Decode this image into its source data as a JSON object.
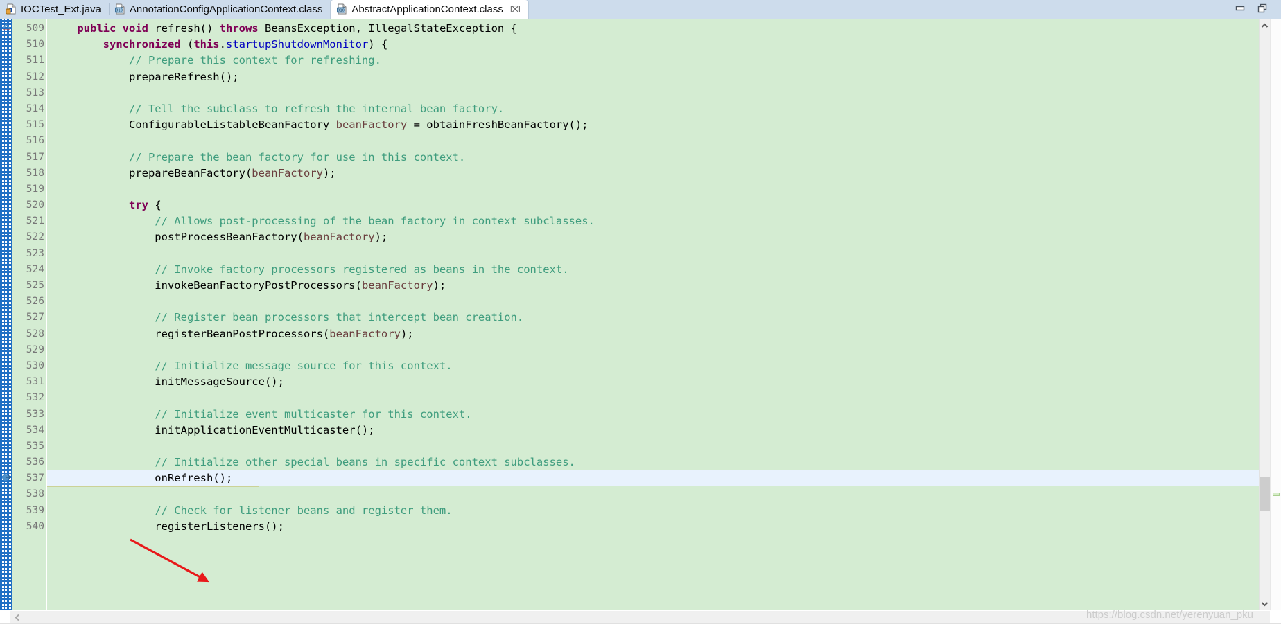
{
  "window": {
    "minimize_label": "Minimize",
    "restore_label": "Restore",
    "min_icon": "minimize-icon",
    "restore_icon": "restore-icon"
  },
  "tabs": [
    {
      "label": "IOCTest_Ext.java",
      "icon": "java-file-icon",
      "active": false,
      "closable": false
    },
    {
      "label": "AnnotationConfigApplicationContext.class",
      "icon": "class-file-icon",
      "active": false,
      "closable": false
    },
    {
      "label": "AbstractApplicationContext.class",
      "icon": "class-file-icon",
      "active": true,
      "closable": true,
      "close_glyph": "⌧"
    }
  ],
  "editor": {
    "first_line": 509,
    "current_line": 537,
    "gutter_marker_icon": "method-override-marker-icon",
    "folding_marker_icon": "fold-collapse-icon",
    "colors": {
      "background": "#d4ecd2",
      "current_line": "#e8f2fd",
      "selection": "#cbd297",
      "keyword": "#7f0055",
      "comment": "#3f9d7e",
      "field": "#0000c0",
      "local_var": "#6a3e3e",
      "plain": "#000000",
      "line_number": "#787878",
      "annotation_bar": "#1f6fc4"
    },
    "lines": [
      {
        "n": 509,
        "tokens": [
          {
            "t": "    ",
            "c": "pln"
          },
          {
            "t": "public",
            "c": "kw"
          },
          {
            "t": " ",
            "c": "pln"
          },
          {
            "t": "void",
            "c": "kw"
          },
          {
            "t": " refresh() ",
            "c": "pln"
          },
          {
            "t": "throws",
            "c": "kw"
          },
          {
            "t": " BeansException, IllegalStateException {",
            "c": "pln"
          }
        ]
      },
      {
        "n": 510,
        "tokens": [
          {
            "t": "        ",
            "c": "pln"
          },
          {
            "t": "synchronized",
            "c": "kw"
          },
          {
            "t": " (",
            "c": "pln"
          },
          {
            "t": "this",
            "c": "kw"
          },
          {
            "t": ".",
            "c": "pln"
          },
          {
            "t": "startupShutdownMonitor",
            "c": "fld"
          },
          {
            "t": ") {",
            "c": "pln"
          }
        ]
      },
      {
        "n": 511,
        "tokens": [
          {
            "t": "            ",
            "c": "pln"
          },
          {
            "t": "// Prepare this context for refreshing.",
            "c": "cmt"
          }
        ]
      },
      {
        "n": 512,
        "tokens": [
          {
            "t": "            prepareRefresh();",
            "c": "pln"
          }
        ]
      },
      {
        "n": 513,
        "tokens": [
          {
            "t": "",
            "c": "pln"
          }
        ]
      },
      {
        "n": 514,
        "tokens": [
          {
            "t": "            ",
            "c": "pln"
          },
          {
            "t": "// Tell the subclass to refresh the internal bean factory.",
            "c": "cmt"
          }
        ]
      },
      {
        "n": 515,
        "tokens": [
          {
            "t": "            ConfigurableListableBeanFactory ",
            "c": "pln"
          },
          {
            "t": "beanFactory",
            "c": "loc"
          },
          {
            "t": " = obtainFreshBeanFactory();",
            "c": "pln"
          }
        ]
      },
      {
        "n": 516,
        "tokens": [
          {
            "t": "",
            "c": "pln"
          }
        ]
      },
      {
        "n": 517,
        "tokens": [
          {
            "t": "            ",
            "c": "pln"
          },
          {
            "t": "// Prepare the bean factory for use in this context.",
            "c": "cmt"
          }
        ]
      },
      {
        "n": 518,
        "tokens": [
          {
            "t": "            prepareBeanFactory(",
            "c": "pln"
          },
          {
            "t": "beanFactory",
            "c": "loc"
          },
          {
            "t": ");",
            "c": "pln"
          }
        ]
      },
      {
        "n": 519,
        "tokens": [
          {
            "t": "",
            "c": "pln"
          }
        ]
      },
      {
        "n": 520,
        "tokens": [
          {
            "t": "            ",
            "c": "pln"
          },
          {
            "t": "try",
            "c": "kw"
          },
          {
            "t": " {",
            "c": "pln"
          }
        ]
      },
      {
        "n": 521,
        "tokens": [
          {
            "t": "                ",
            "c": "pln"
          },
          {
            "t": "// Allows post-processing of the bean factory in context subclasses.",
            "c": "cmt"
          }
        ]
      },
      {
        "n": 522,
        "tokens": [
          {
            "t": "                postProcessBeanFactory(",
            "c": "pln"
          },
          {
            "t": "beanFactory",
            "c": "loc"
          },
          {
            "t": ");",
            "c": "pln"
          }
        ]
      },
      {
        "n": 523,
        "tokens": [
          {
            "t": "",
            "c": "pln"
          }
        ]
      },
      {
        "n": 524,
        "tokens": [
          {
            "t": "                ",
            "c": "pln"
          },
          {
            "t": "// Invoke factory processors registered as beans in the context.",
            "c": "cmt"
          }
        ]
      },
      {
        "n": 525,
        "tokens": [
          {
            "t": "                invokeBeanFactoryPostProcessors(",
            "c": "pln"
          },
          {
            "t": "beanFactory",
            "c": "loc"
          },
          {
            "t": ");",
            "c": "pln"
          }
        ]
      },
      {
        "n": 526,
        "tokens": [
          {
            "t": "",
            "c": "pln"
          }
        ]
      },
      {
        "n": 527,
        "tokens": [
          {
            "t": "                ",
            "c": "pln"
          },
          {
            "t": "// Register bean processors that intercept bean creation.",
            "c": "cmt"
          }
        ]
      },
      {
        "n": 528,
        "tokens": [
          {
            "t": "                registerBeanPostProcessors(",
            "c": "pln"
          },
          {
            "t": "beanFactory",
            "c": "loc"
          },
          {
            "t": ");",
            "c": "pln"
          }
        ]
      },
      {
        "n": 529,
        "tokens": [
          {
            "t": "",
            "c": "pln"
          }
        ]
      },
      {
        "n": 530,
        "tokens": [
          {
            "t": "                ",
            "c": "pln"
          },
          {
            "t": "// Initialize message source for this context.",
            "c": "cmt"
          }
        ]
      },
      {
        "n": 531,
        "tokens": [
          {
            "t": "                initMessageSource();",
            "c": "pln"
          }
        ]
      },
      {
        "n": 532,
        "tokens": [
          {
            "t": "",
            "c": "pln"
          }
        ]
      },
      {
        "n": 533,
        "tokens": [
          {
            "t": "                ",
            "c": "pln"
          },
          {
            "t": "// Initialize event multicaster for this context.",
            "c": "cmt"
          }
        ]
      },
      {
        "n": 534,
        "tokens": [
          {
            "t": "                initApplicationEventMulticaster();",
            "c": "pln"
          }
        ]
      },
      {
        "n": 535,
        "tokens": [
          {
            "t": "",
            "c": "pln"
          }
        ]
      },
      {
        "n": 536,
        "tokens": [
          {
            "t": "                ",
            "c": "pln"
          },
          {
            "t": "// Initialize other special beans in specific context subclasses.",
            "c": "cmt"
          }
        ]
      },
      {
        "n": 537,
        "tokens": [
          {
            "t": "                onRefresh();",
            "c": "pln"
          }
        ],
        "current": true,
        "selection_width": 306
      },
      {
        "n": 538,
        "tokens": [
          {
            "t": "",
            "c": "pln"
          }
        ]
      },
      {
        "n": 539,
        "tokens": [
          {
            "t": "                ",
            "c": "pln"
          },
          {
            "t": "// Check for listener beans and register them.",
            "c": "cmt"
          }
        ]
      },
      {
        "n": 540,
        "tokens": [
          {
            "t": "                registerListeners();",
            "c": "pln"
          }
        ]
      }
    ]
  },
  "scrollbars": {
    "vertical": {
      "up_arrow_icon": "chevron-up-icon",
      "down_arrow_icon": "chevron-down-icon",
      "thumb_label": "vertical-scroll-thumb"
    },
    "horizontal": {
      "left_arrow_icon": "chevron-left-icon"
    },
    "overview_marker_label": "overview-ruler-marker"
  },
  "annotation": {
    "arrow_label": "red-pointer-arrow",
    "arrow_color": "#e8191a"
  },
  "watermark": {
    "text": "https://blog.csdn.net/yerenyuan_pku"
  }
}
